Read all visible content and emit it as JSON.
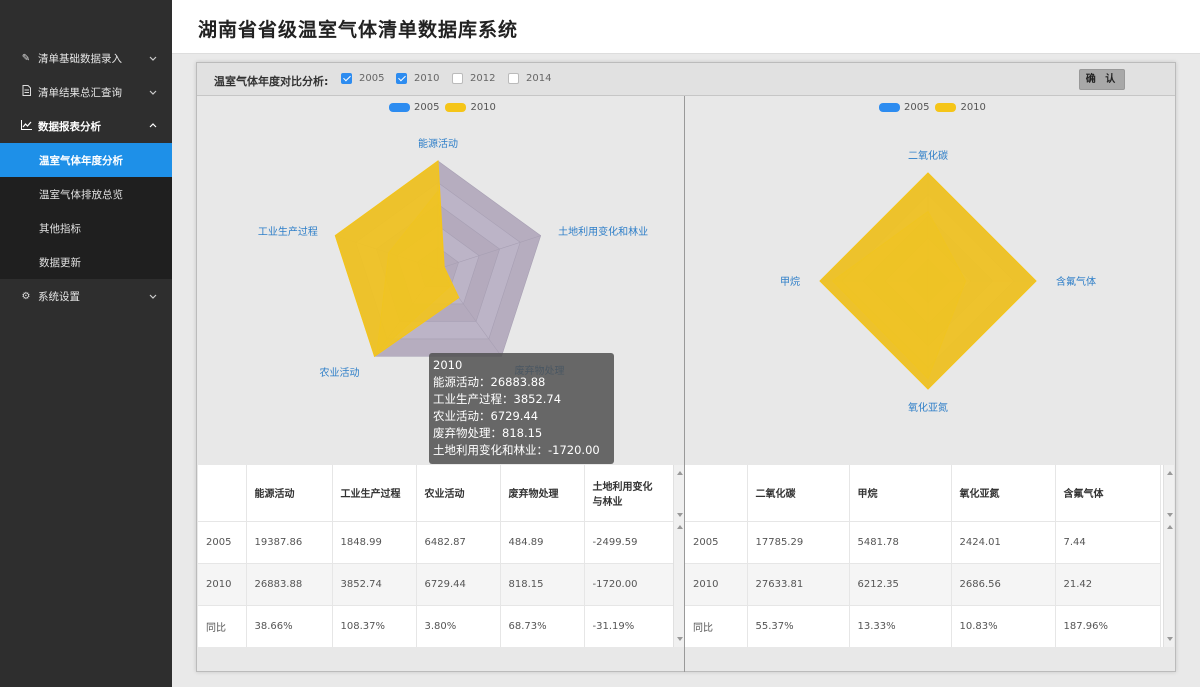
{
  "app_title": "湖南省省级温室气体清单数据库系统",
  "sidebar": {
    "groups": [
      {
        "icon": "edit-icon",
        "label": "清单基础数据录入"
      },
      {
        "icon": "document-icon",
        "label": "清单结果总汇查询"
      },
      {
        "icon": "chart-icon",
        "label": "数据报表分析"
      },
      {
        "icon": "gear-icon",
        "label": "系统设置"
      }
    ],
    "sub_items": [
      "温室气体年度分析",
      "温室气体排放总览",
      "其他指标",
      "数据更新"
    ]
  },
  "toolbar": {
    "label": "温室气体年度对比分析:",
    "checkboxes": [
      {
        "label": "2005",
        "checked": true
      },
      {
        "label": "2010",
        "checked": true
      },
      {
        "label": "2012",
        "checked": false
      },
      {
        "label": "2014",
        "checked": false
      }
    ],
    "confirm_label": "确 认"
  },
  "colors": {
    "series_2005": "#2d8cf0",
    "series_2010": "#f5c518",
    "radar_bg": "#b3aabd"
  },
  "chart_data": [
    {
      "type": "radar",
      "indicators": [
        "能源活动",
        "土地利用变化和林业",
        "废弃物处理",
        "农业活动",
        "工业生产过程"
      ],
      "series": [
        {
          "name": "2005",
          "values": [
            19387.86,
            -2499.59,
            484.89,
            6482.87,
            1848.99
          ]
        },
        {
          "name": "2010",
          "values": [
            26883.88,
            -1720.0,
            818.15,
            6729.44,
            3852.74
          ]
        }
      ]
    },
    {
      "type": "radar",
      "indicators": [
        "二氧化碳",
        "含氟气体",
        "氧化亚氮",
        "甲烷"
      ],
      "series": [
        {
          "name": "2005",
          "values": [
            17785.29,
            7.44,
            2424.01,
            5481.78
          ]
        },
        {
          "name": "2010",
          "values": [
            27633.81,
            21.42,
            2686.56,
            6212.35
          ]
        }
      ]
    }
  ],
  "tooltip": {
    "title": "2010",
    "lines": [
      "能源活动：26883.88",
      "工业生产过程：3852.74",
      "农业活动：6729.44",
      "废弃物处理：818.15",
      "土地利用变化和林业：-1720.00"
    ]
  },
  "table_left": {
    "headers": [
      "",
      "能源活动",
      "工业生产过程",
      "农业活动",
      "废弃物处理",
      "土地利用变化与林业"
    ],
    "rows": [
      [
        "2005",
        "19387.86",
        "1848.99",
        "6482.87",
        "484.89",
        "-2499.59"
      ],
      [
        "2010",
        "26883.88",
        "3852.74",
        "6729.44",
        "818.15",
        "-1720.00"
      ],
      [
        "同比",
        "38.66%",
        "108.37%",
        "3.80%",
        "68.73%",
        "-31.19%"
      ]
    ]
  },
  "table_right": {
    "headers": [
      "",
      "二氧化碳",
      "甲烷",
      "氧化亚氮",
      "含氟气体"
    ],
    "rows": [
      [
        "2005",
        "17785.29",
        "5481.78",
        "2424.01",
        "7.44"
      ],
      [
        "2010",
        "27633.81",
        "6212.35",
        "2686.56",
        "21.42"
      ],
      [
        "同比",
        "55.37%",
        "13.33%",
        "10.83%",
        "187.96%"
      ]
    ]
  }
}
